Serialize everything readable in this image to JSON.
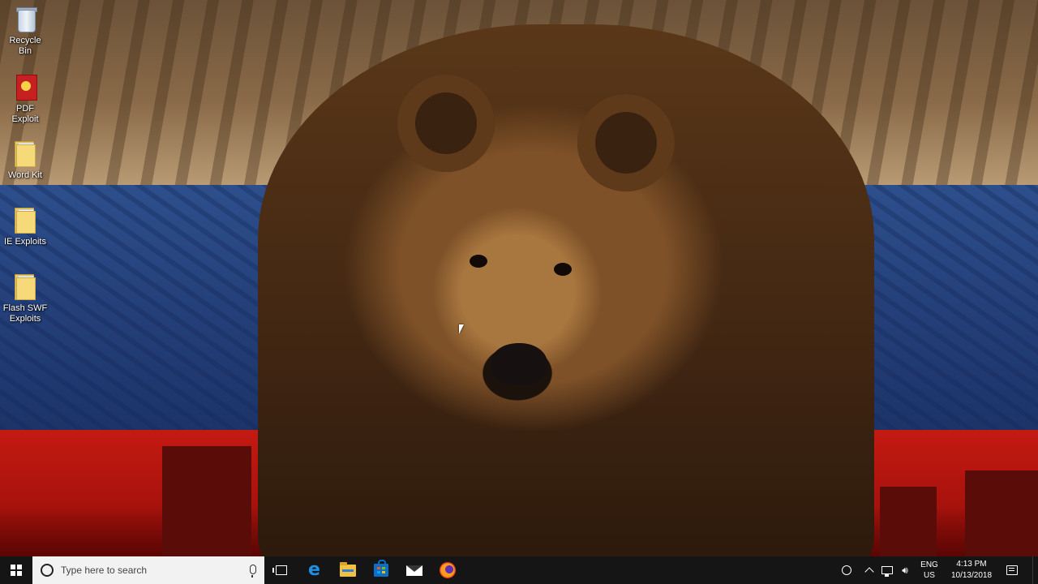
{
  "desktop": {
    "icons": [
      {
        "label": "Recycle Bin",
        "icon": "recycle-bin-icon"
      },
      {
        "label": "PDF Exploit",
        "icon": "pdf-document-icon"
      },
      {
        "label": "Word Kit",
        "icon": "folder-icon"
      },
      {
        "label": "IE Exploits",
        "icon": "folder-icon"
      },
      {
        "label": "Flash SWF Exploits",
        "icon": "folder-icon"
      }
    ],
    "wallpaper": "bear-wallpaper"
  },
  "taskbar": {
    "search": {
      "placeholder": "Type here to search"
    },
    "pinned": [
      {
        "name": "task-view",
        "icon": "task-view-icon"
      },
      {
        "name": "edge",
        "icon": "edge-icon"
      },
      {
        "name": "file-explorer",
        "icon": "folder-icon"
      },
      {
        "name": "store",
        "icon": "store-icon"
      },
      {
        "name": "mail",
        "icon": "mail-icon"
      },
      {
        "name": "firefox",
        "icon": "firefox-icon"
      }
    ],
    "tray": {
      "language": {
        "line1": "ENG",
        "line2": "US"
      },
      "clock": {
        "time": "4:13 PM",
        "date": "10/13/2018"
      }
    }
  },
  "colors": {
    "taskbar_bg": "#151515",
    "search_bg": "#f2f2f2",
    "edge_blue": "#1f8fe6",
    "wallpaper_red": "#c41a12",
    "wallpaper_blue": "#2d4f8c"
  }
}
